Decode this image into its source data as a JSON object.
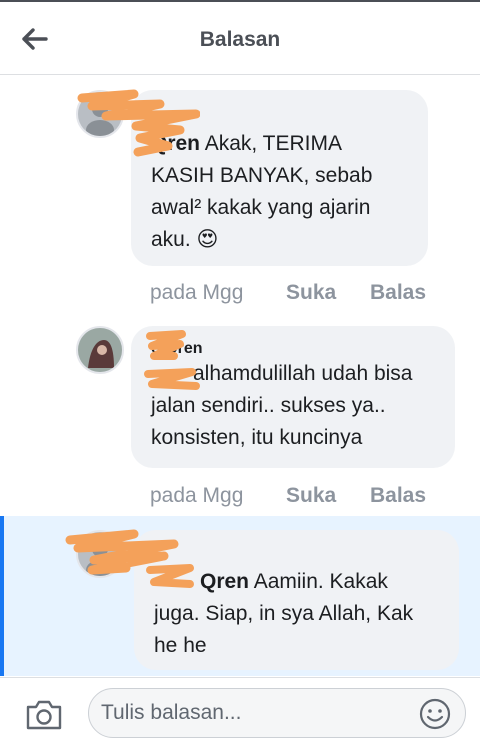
{
  "header": {
    "title": "Balasan"
  },
  "comments": [
    {
      "name": "Qren",
      "text": " Akak, TERIMA KASIH BANYAK, sebab awal² kakak yang ajarin aku. 😍",
      "time": "pada Mgg",
      "like": "Suka",
      "reply": "Balas"
    },
    {
      "name": "o Qren",
      "text": "alhamdulillah udah bisa jalan sendiri.. sukses ya.. konsisten, itu kuncinya",
      "time": "pada Mgg",
      "like": "Suka",
      "reply": "Balas"
    },
    {
      "name": "Qren",
      "text": " Aamiin. Kakak juga. Siap, in sya Allah, Kak he he"
    }
  ],
  "composer": {
    "placeholder": "Tulis balasan..."
  },
  "colors": {
    "accent": "#1877f2",
    "highlight_bg": "#e7f3ff",
    "scribble": "#f4a15a"
  }
}
